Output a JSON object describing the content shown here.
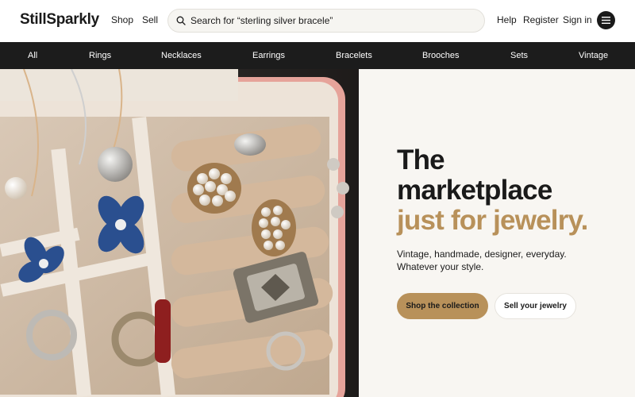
{
  "header": {
    "logo": "StillSparkly",
    "nav": [
      "Shop",
      "Sell"
    ],
    "search_value": "sterling silver bracele",
    "search_placeholder": "Search for “sterling silver bracele”",
    "help": "Help",
    "register": "Register",
    "signin": "Sign in"
  },
  "categories": [
    "All",
    "Rings",
    "Necklaces",
    "Earrings",
    "Bracelets",
    "Brooches",
    "Sets",
    "Vintage"
  ],
  "hero": {
    "line1": "The",
    "line2": "marketplace",
    "line3": "just for jewelry.",
    "sub1": "Vintage, handmade, designer, everyday.",
    "sub2": "Whatever your style.",
    "primary_cta": "Shop the collection",
    "secondary_cta": "Sell your jewelry"
  },
  "colors": {
    "accent": "#b8915a",
    "dark_bar": "#1c1c1c",
    "panel_bg": "#f8f6f2"
  }
}
